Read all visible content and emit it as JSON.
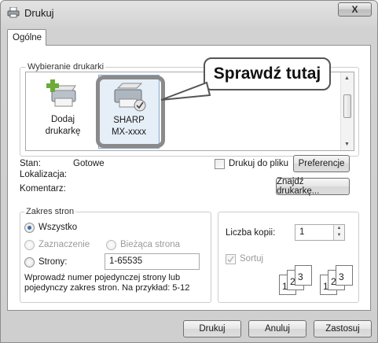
{
  "window": {
    "title": "Drukuj",
    "close_label": "X"
  },
  "tabs": [
    {
      "label": "Ogólne"
    }
  ],
  "printer_group": {
    "legend": "Wybieranie drukarki",
    "printers": [
      {
        "line1": "Dodaj",
        "line2": "drukarkę"
      },
      {
        "line1": "SHARP",
        "line2": "MX-xxxx"
      }
    ]
  },
  "callout": {
    "text": "Sprawdź tutaj"
  },
  "status": {
    "stan_label": "Stan:",
    "stan_value": "Gotowe",
    "lokalizacja_label": "Lokalizacja:",
    "komentarz_label": "Komentarz:",
    "print_to_file_label": "Drukuj do pliku",
    "preferences_button": "Preferencje",
    "find_printer_button": "Znajdź drukarkę..."
  },
  "page_range": {
    "legend": "Zakres stron",
    "all_label": "Wszystko",
    "selection_label": "Zaznaczenie",
    "current_page_label": "Bieżąca strona",
    "pages_label": "Strony:",
    "pages_value": "1-65535",
    "hint": "Wprowadź numer pojedynczej strony lub pojedynczy zakres stron. Na przykład: 5-12"
  },
  "copies": {
    "count_label": "Liczba kopii:",
    "count_value": "1",
    "collate_label": "Sortuj"
  },
  "footer": {
    "print_button": "Drukuj",
    "cancel_button": "Anuluj",
    "apply_button": "Zastosuj"
  }
}
